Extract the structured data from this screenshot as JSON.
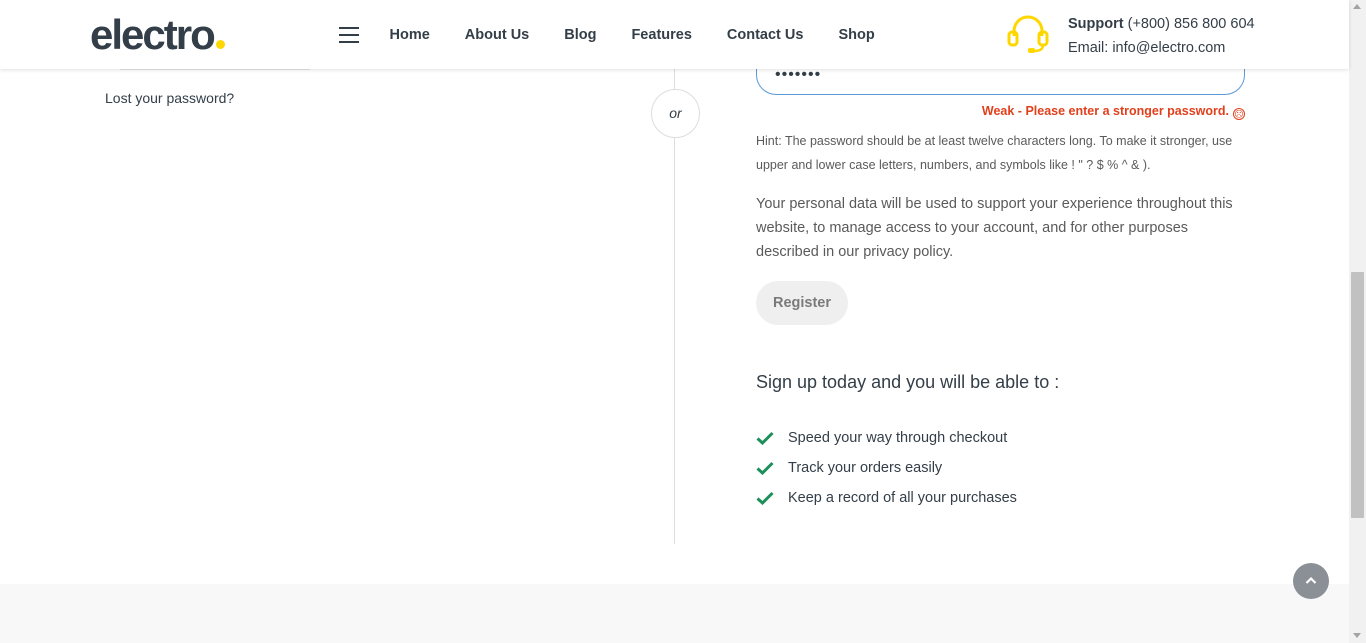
{
  "header": {
    "logo_text": "electro",
    "logo_dot_color": "#fed700",
    "nav": [
      {
        "label": "Home"
      },
      {
        "label": "About Us"
      },
      {
        "label": "Blog"
      },
      {
        "label": "Features"
      },
      {
        "label": "Contact Us"
      },
      {
        "label": "Shop"
      }
    ],
    "support_icon": "headset-icon",
    "support_label": "Support",
    "support_phone": "(+800) 856 800 604",
    "support_email": "Email: info@electro.com"
  },
  "login": {
    "lost_password": "Lost your password?"
  },
  "divider": {
    "or_label": "or"
  },
  "register": {
    "password_value": "•••••••",
    "strength_message": "Weak - Please enter a stronger password.",
    "strength_color": "#e2401c",
    "hint": "Hint: The password should be at least twelve characters long. To make it stronger, use upper and lower case letters, numbers, and symbols like ! \" ? $ % ^ & ).",
    "privacy_text": "Your personal data will be used to support your experience throughout this website, to manage access to your account, and for other purposes described in our ",
    "privacy_link": "privacy policy",
    "privacy_end": ".",
    "button_label": "Register"
  },
  "benefits": {
    "title": "Sign up today and you will be able to :",
    "check_color": "#1e8f5b",
    "items": [
      {
        "label": "Speed your way through checkout"
      },
      {
        "label": "Track your orders easily"
      },
      {
        "label": "Keep a record of all your purchases"
      }
    ]
  },
  "back_to_top_icon": "chevron-up-icon"
}
